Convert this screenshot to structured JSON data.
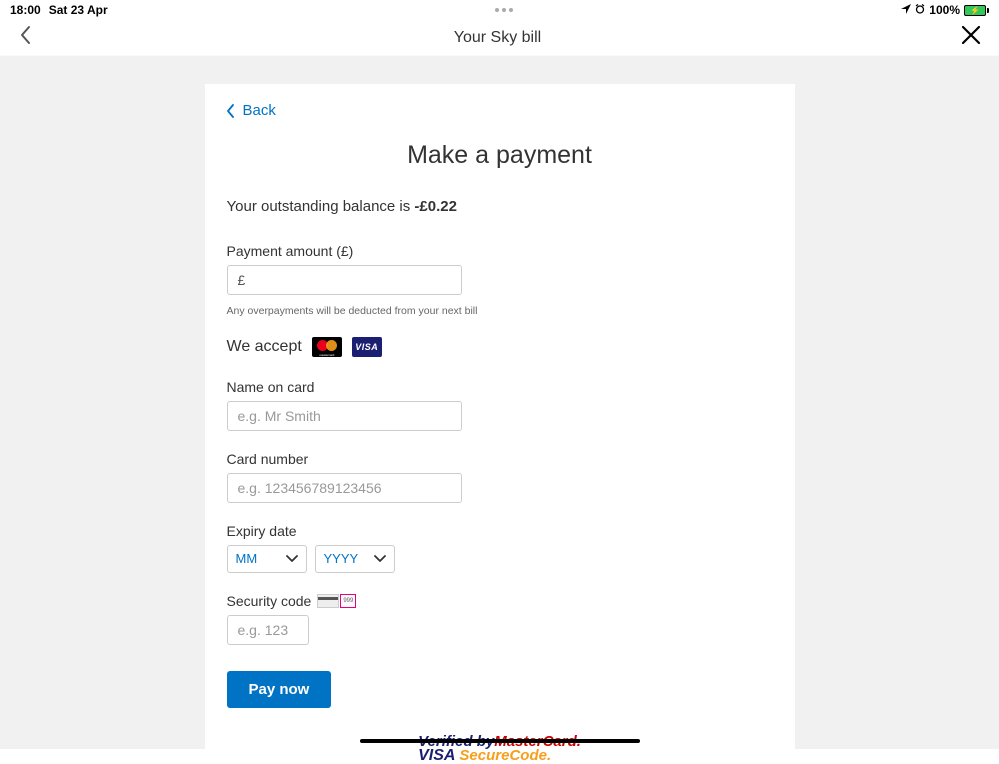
{
  "status": {
    "time": "18:00",
    "date": "Sat 23 Apr",
    "battery_pct": "100%"
  },
  "nav": {
    "title": "Your Sky bill"
  },
  "back": {
    "label": "Back"
  },
  "page": {
    "title": "Make a payment",
    "balance_prefix": "Your outstanding balance is ",
    "balance_amount": "-£0.22"
  },
  "form": {
    "amount_label": "Payment amount (£)",
    "amount_prefix": "£",
    "overpay_hint": "Any overpayments will be deducted from your next bill",
    "accept_label": "We accept",
    "name_label": "Name on card",
    "name_placeholder": "e.g. Mr Smith",
    "card_label": "Card number",
    "card_placeholder": "e.g. 123456789123456",
    "expiry_label": "Expiry date",
    "expiry_mm": "MM",
    "expiry_yyyy": "YYYY",
    "security_label": "Security code",
    "security_placeholder": "e.g. 123",
    "cvv_sample": "999",
    "pay_label": "Pay now"
  },
  "verified": {
    "verified_by": "Verified by",
    "mastercard": "MasterCard.",
    "visa": "VISA",
    "securecode": "SecureCode."
  },
  "visa_label": "VISA"
}
